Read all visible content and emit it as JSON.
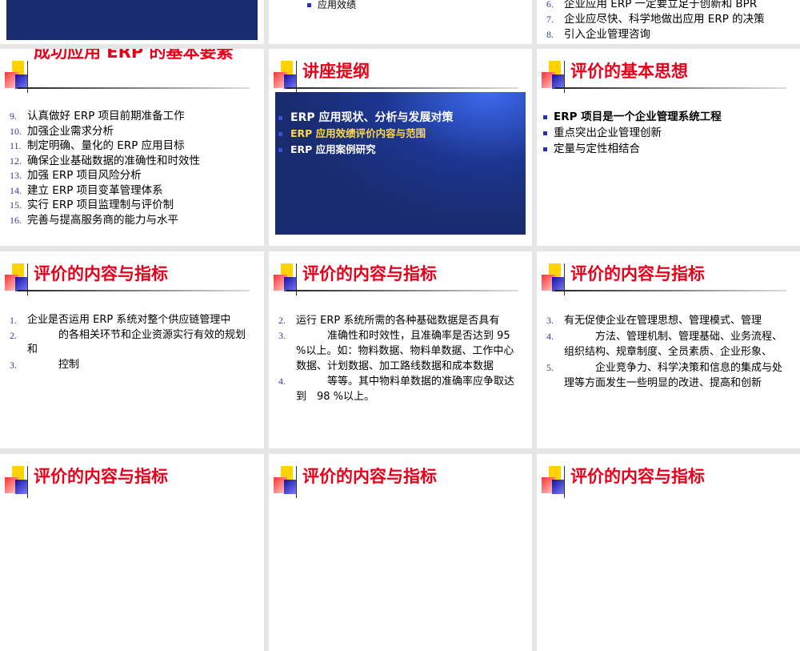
{
  "slides": [
    {
      "id": "top-mid",
      "bullet": "应用效绩"
    },
    {
      "id": "top-right",
      "items": [
        {
          "n": "6.",
          "text": "企业应用 ERP 一定要立足于创新和 BPR"
        },
        {
          "n": "7.",
          "text": "企业应尽快、科学地做出应用 ERP 的决策"
        },
        {
          "n": "8.",
          "text": "引入企业管理咨询"
        }
      ]
    },
    {
      "id": "success",
      "title": "成功应用 ERP 的基本要素",
      "items": [
        {
          "n": "9.",
          "text": "认真做好 ERP 项目前期准备工作"
        },
        {
          "n": "10.",
          "text": "加强企业需求分析"
        },
        {
          "n": "11.",
          "text": "制定明确、量化的 ERP 应用目标"
        },
        {
          "n": "12.",
          "text": "确保企业基础数据的准确性和时效性"
        },
        {
          "n": "13.",
          "text": "加强 ERP 项目风险分析"
        },
        {
          "n": "14.",
          "text": "建立 ERP 项目变革管理体系"
        },
        {
          "n": "15.",
          "text": "实行 ERP 项目监理制与评价制"
        },
        {
          "n": "16.",
          "text": "完善与提高服务商的能力与水平"
        }
      ]
    },
    {
      "id": "outline",
      "title": "讲座提纲",
      "items": [
        "ERP 应用现状、分析与发展对策",
        "ERP 应用效绩评价内容与范围",
        "ERP 应用案例研究"
      ],
      "highlight_color": "#ffd84a"
    },
    {
      "id": "basic",
      "title": "评价的基本思想",
      "items": [
        "ERP 项目是一个企业管理系统工程",
        "重点突出企业管理创新",
        "定量与定性相结合"
      ]
    },
    {
      "id": "content1",
      "title": "评价的内容与指标",
      "items": [
        {
          "n": "1.",
          "text": "企业是否运用 ERP 系统对整个供应链管理中"
        },
        {
          "n": "2.",
          "text": "　　　的各相关环节和企业资源实行有效的规划和"
        },
        {
          "n": "3.",
          "text": "　　　控制"
        }
      ]
    },
    {
      "id": "content2",
      "title": "评价的内容与指标",
      "items": [
        {
          "n": "2.",
          "text": "运行 ERP 系统所需的各种基础数据是否具有"
        },
        {
          "n": "3.",
          "text": "　　　准确性和时效性，且准确率是否达到 95 %以上。如：物料数据、物料单数据、工作中心数据、计划数据、加工路线数据和成本数据"
        },
        {
          "n": "4.",
          "text": "　　　等等。其中物料单数据的准确率应争取达到　98 %以上。"
        }
      ]
    },
    {
      "id": "content3",
      "title": "评价的内容与指标",
      "items": [
        {
          "n": "3.",
          "text": "有无促使企业在管理思想、管理模式、管理"
        },
        {
          "n": "4.",
          "text": "　　　方法、管理机制、管理基础、业务流程、组织结构、规章制度、全员素质、企业形象、"
        },
        {
          "n": "5.",
          "text": "　　　企业竞争力、科学决策和信息的集成与处理等方面发生一些明显的改进、提高和创新"
        }
      ]
    },
    {
      "id": "bottom1",
      "title": "评价的内容与指标"
    },
    {
      "id": "bottom2",
      "title": "评价的内容与指标"
    },
    {
      "id": "bottom3",
      "title": "评价的内容与指标"
    }
  ]
}
